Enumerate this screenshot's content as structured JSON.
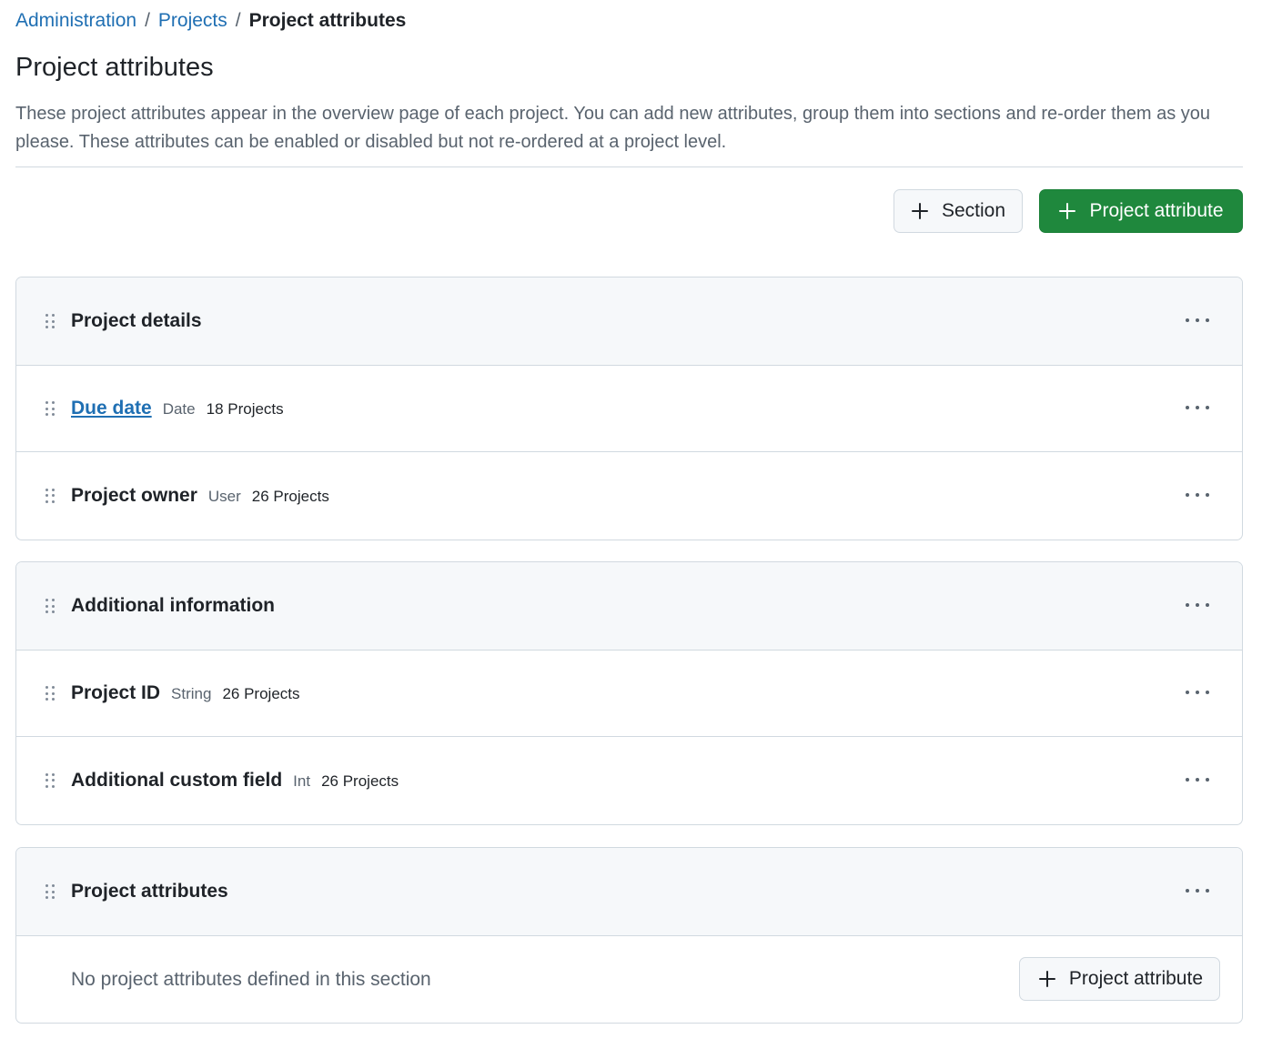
{
  "breadcrumb": {
    "items": [
      "Administration",
      "Projects"
    ],
    "separator": "/",
    "current": "Project attributes"
  },
  "page": {
    "title": "Project attributes",
    "description": "These project attributes appear in the overview page of each project. You can add new attributes, group them into sections and re-order them as you please. These attributes can be enabled or disabled but not re-ordered at a project level."
  },
  "actions": {
    "add_section_label": "Section",
    "add_attribute_label": "Project attribute"
  },
  "sections": [
    {
      "title": "Project details",
      "attributes": [
        {
          "name": "Due date",
          "type": "Date",
          "count": "18 Projects",
          "is_link": true
        },
        {
          "name": "Project owner",
          "type": "User",
          "count": "26 Projects",
          "is_link": false
        }
      ]
    },
    {
      "title": "Additional information",
      "attributes": [
        {
          "name": "Project ID",
          "type": "String",
          "count": "26 Projects",
          "is_link": false
        },
        {
          "name": "Additional custom field",
          "type": "Int",
          "count": "26 Projects",
          "is_link": false
        }
      ]
    },
    {
      "title": "Project attributes",
      "attributes": [],
      "empty_text": "No project attributes defined in this section",
      "add_label": "Project attribute"
    }
  ],
  "colors": {
    "link": "#1f6fb3",
    "primary_button": "#1f883d",
    "header_bg": "#f6f8fa",
    "border": "#d1d9e0",
    "muted_text": "#59636e"
  },
  "icons": {
    "drag_handle": "grabber-icon",
    "more_actions": "kebab-horizontal-icon",
    "add": "plus-icon"
  }
}
